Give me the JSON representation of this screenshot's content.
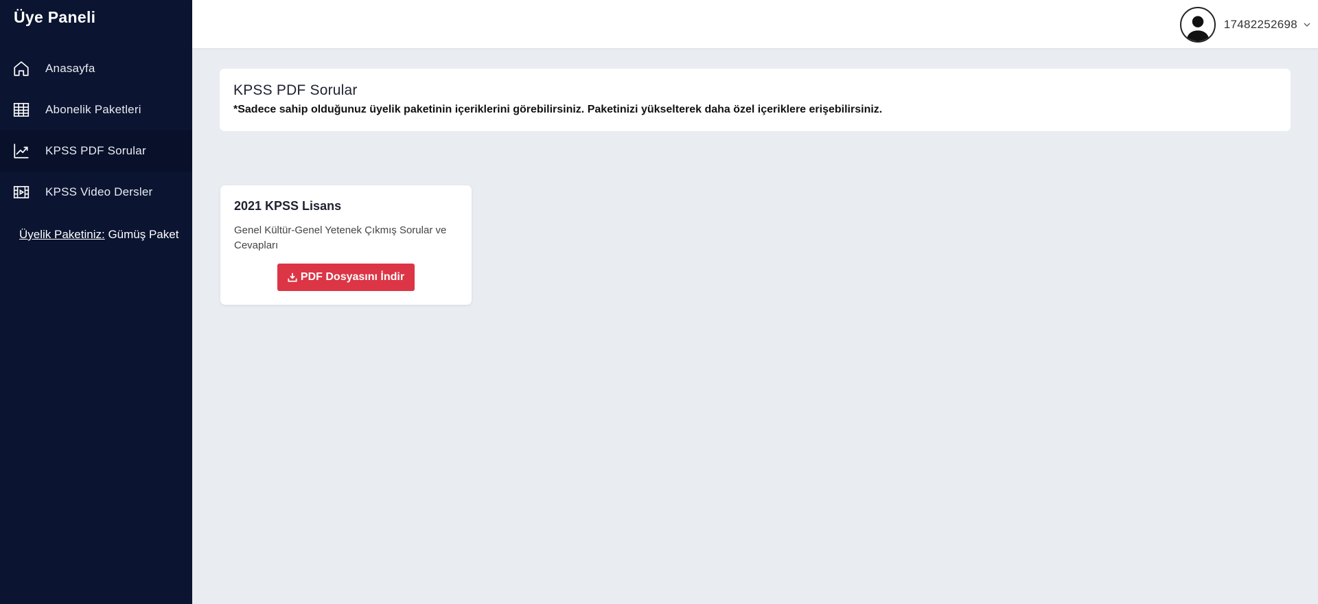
{
  "sidebar": {
    "title": "Üye Paneli",
    "items": [
      {
        "label": "Anasayfa",
        "icon": "home-icon"
      },
      {
        "label": "Abonelik Paketleri",
        "icon": "grid-table-icon"
      },
      {
        "label": "KPSS PDF Sorular",
        "icon": "trending-chart-icon",
        "active": true
      },
      {
        "label": "KPSS Video Dersler",
        "icon": "film-icon"
      }
    ],
    "membership": {
      "key": "Üyelik Paketiniz:",
      "value": " Gümüş Paket"
    }
  },
  "topbar": {
    "username": "17482252698",
    "avatar_icon": "user-avatar-icon",
    "chevron_icon": "chevron-down-icon"
  },
  "main": {
    "header": {
      "title": "KPSS PDF Sorular",
      "note": "*Sadece sahip olduğunuz üyelik paketinin içeriklerini görebilirsiniz. Paketinizi yükselterek daha özel içeriklere erişebilirsiniz."
    },
    "cards": [
      {
        "title": "2021 KPSS Lisans",
        "description": "Genel Kültür-Genel Yetenek Çıkmış Sorular ve Cevapları",
        "button": "PDF Dosyasını İndir",
        "button_icon": "download-icon"
      }
    ]
  },
  "colors": {
    "sidebar_bg": "#0b1430",
    "page_bg": "#e9ecf1",
    "danger": "#dc3545"
  }
}
